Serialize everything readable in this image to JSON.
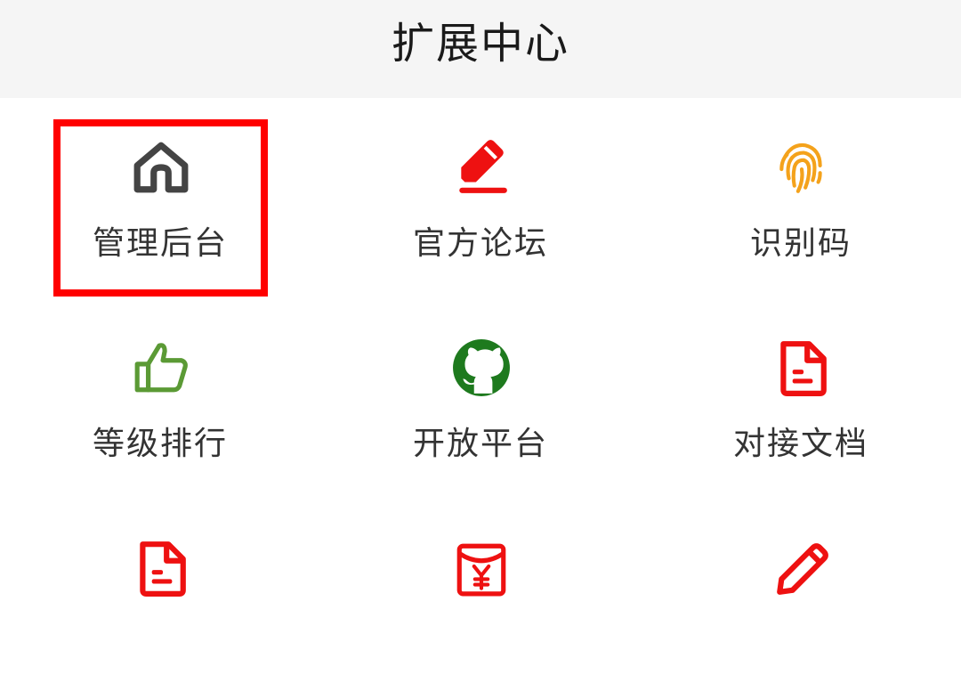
{
  "header": {
    "title": "扩展中心"
  },
  "items": [
    {
      "label": "管理后台",
      "icon": "home-icon",
      "color": "#444444"
    },
    {
      "label": "官方论坛",
      "icon": "pencil-underline-icon",
      "color": "#ee1111"
    },
    {
      "label": "识别码",
      "icon": "fingerprint-icon",
      "color": "#f4a21b"
    },
    {
      "label": "等级排行",
      "icon": "thumbs-up-icon",
      "color": "#5b9a35"
    },
    {
      "label": "开放平台",
      "icon": "github-icon",
      "color": "#1e7a1e"
    },
    {
      "label": "对接文档",
      "icon": "document-icon",
      "color": "#ee1111"
    },
    {
      "label": "",
      "icon": "document-icon",
      "color": "#ee1111"
    },
    {
      "label": "",
      "icon": "red-envelope-yuan-icon",
      "color": "#ee1111"
    },
    {
      "label": "",
      "icon": "pencil-icon",
      "color": "#ee1111"
    }
  ],
  "highlight_color": "#ff0000"
}
